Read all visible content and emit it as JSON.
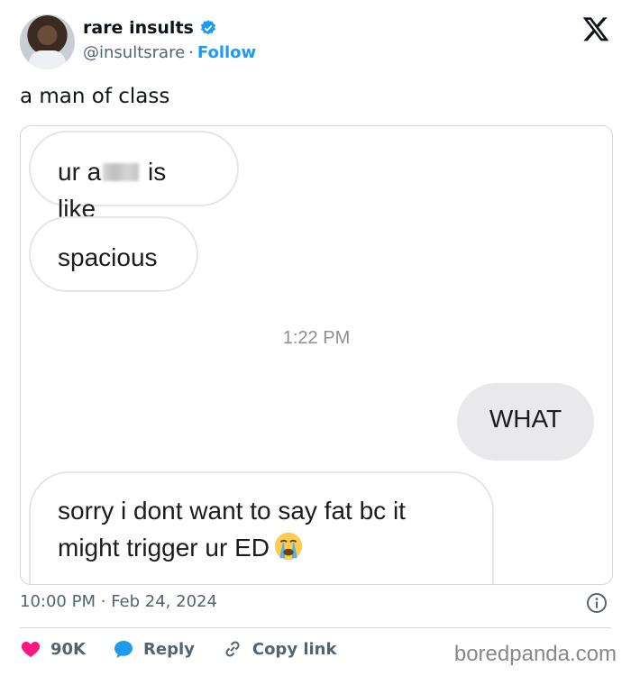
{
  "author": {
    "name": "rare insults",
    "handle": "@insultsrare",
    "separator": "·",
    "follow_label": "Follow"
  },
  "tweet": {
    "text": "a man of class",
    "time": "10:00 PM",
    "date_separator": "·",
    "date": "Feb 24, 2024"
  },
  "screenshot": {
    "messages": [
      {
        "side": "left",
        "text_before": "ur a",
        "text_after": " is like",
        "censored": true
      },
      {
        "side": "left",
        "text": "spacious"
      },
      {
        "side": "right",
        "text": "WHAT"
      },
      {
        "side": "left",
        "text_line1": "sorry i dont want to say fat bc it",
        "text_line2": "might trigger ur ED",
        "emoji": "crying-face-icon"
      }
    ],
    "timestamp": "1:22 PM"
  },
  "actions": {
    "likes": "90K",
    "reply_label": "Reply",
    "copy_link_label": "Copy link"
  },
  "watermark": "boredpanda.com",
  "colors": {
    "accent": "#1d9bf0",
    "like": "#f91880",
    "text_secondary": "#536471",
    "bubble_right": "#e9e9eb"
  }
}
